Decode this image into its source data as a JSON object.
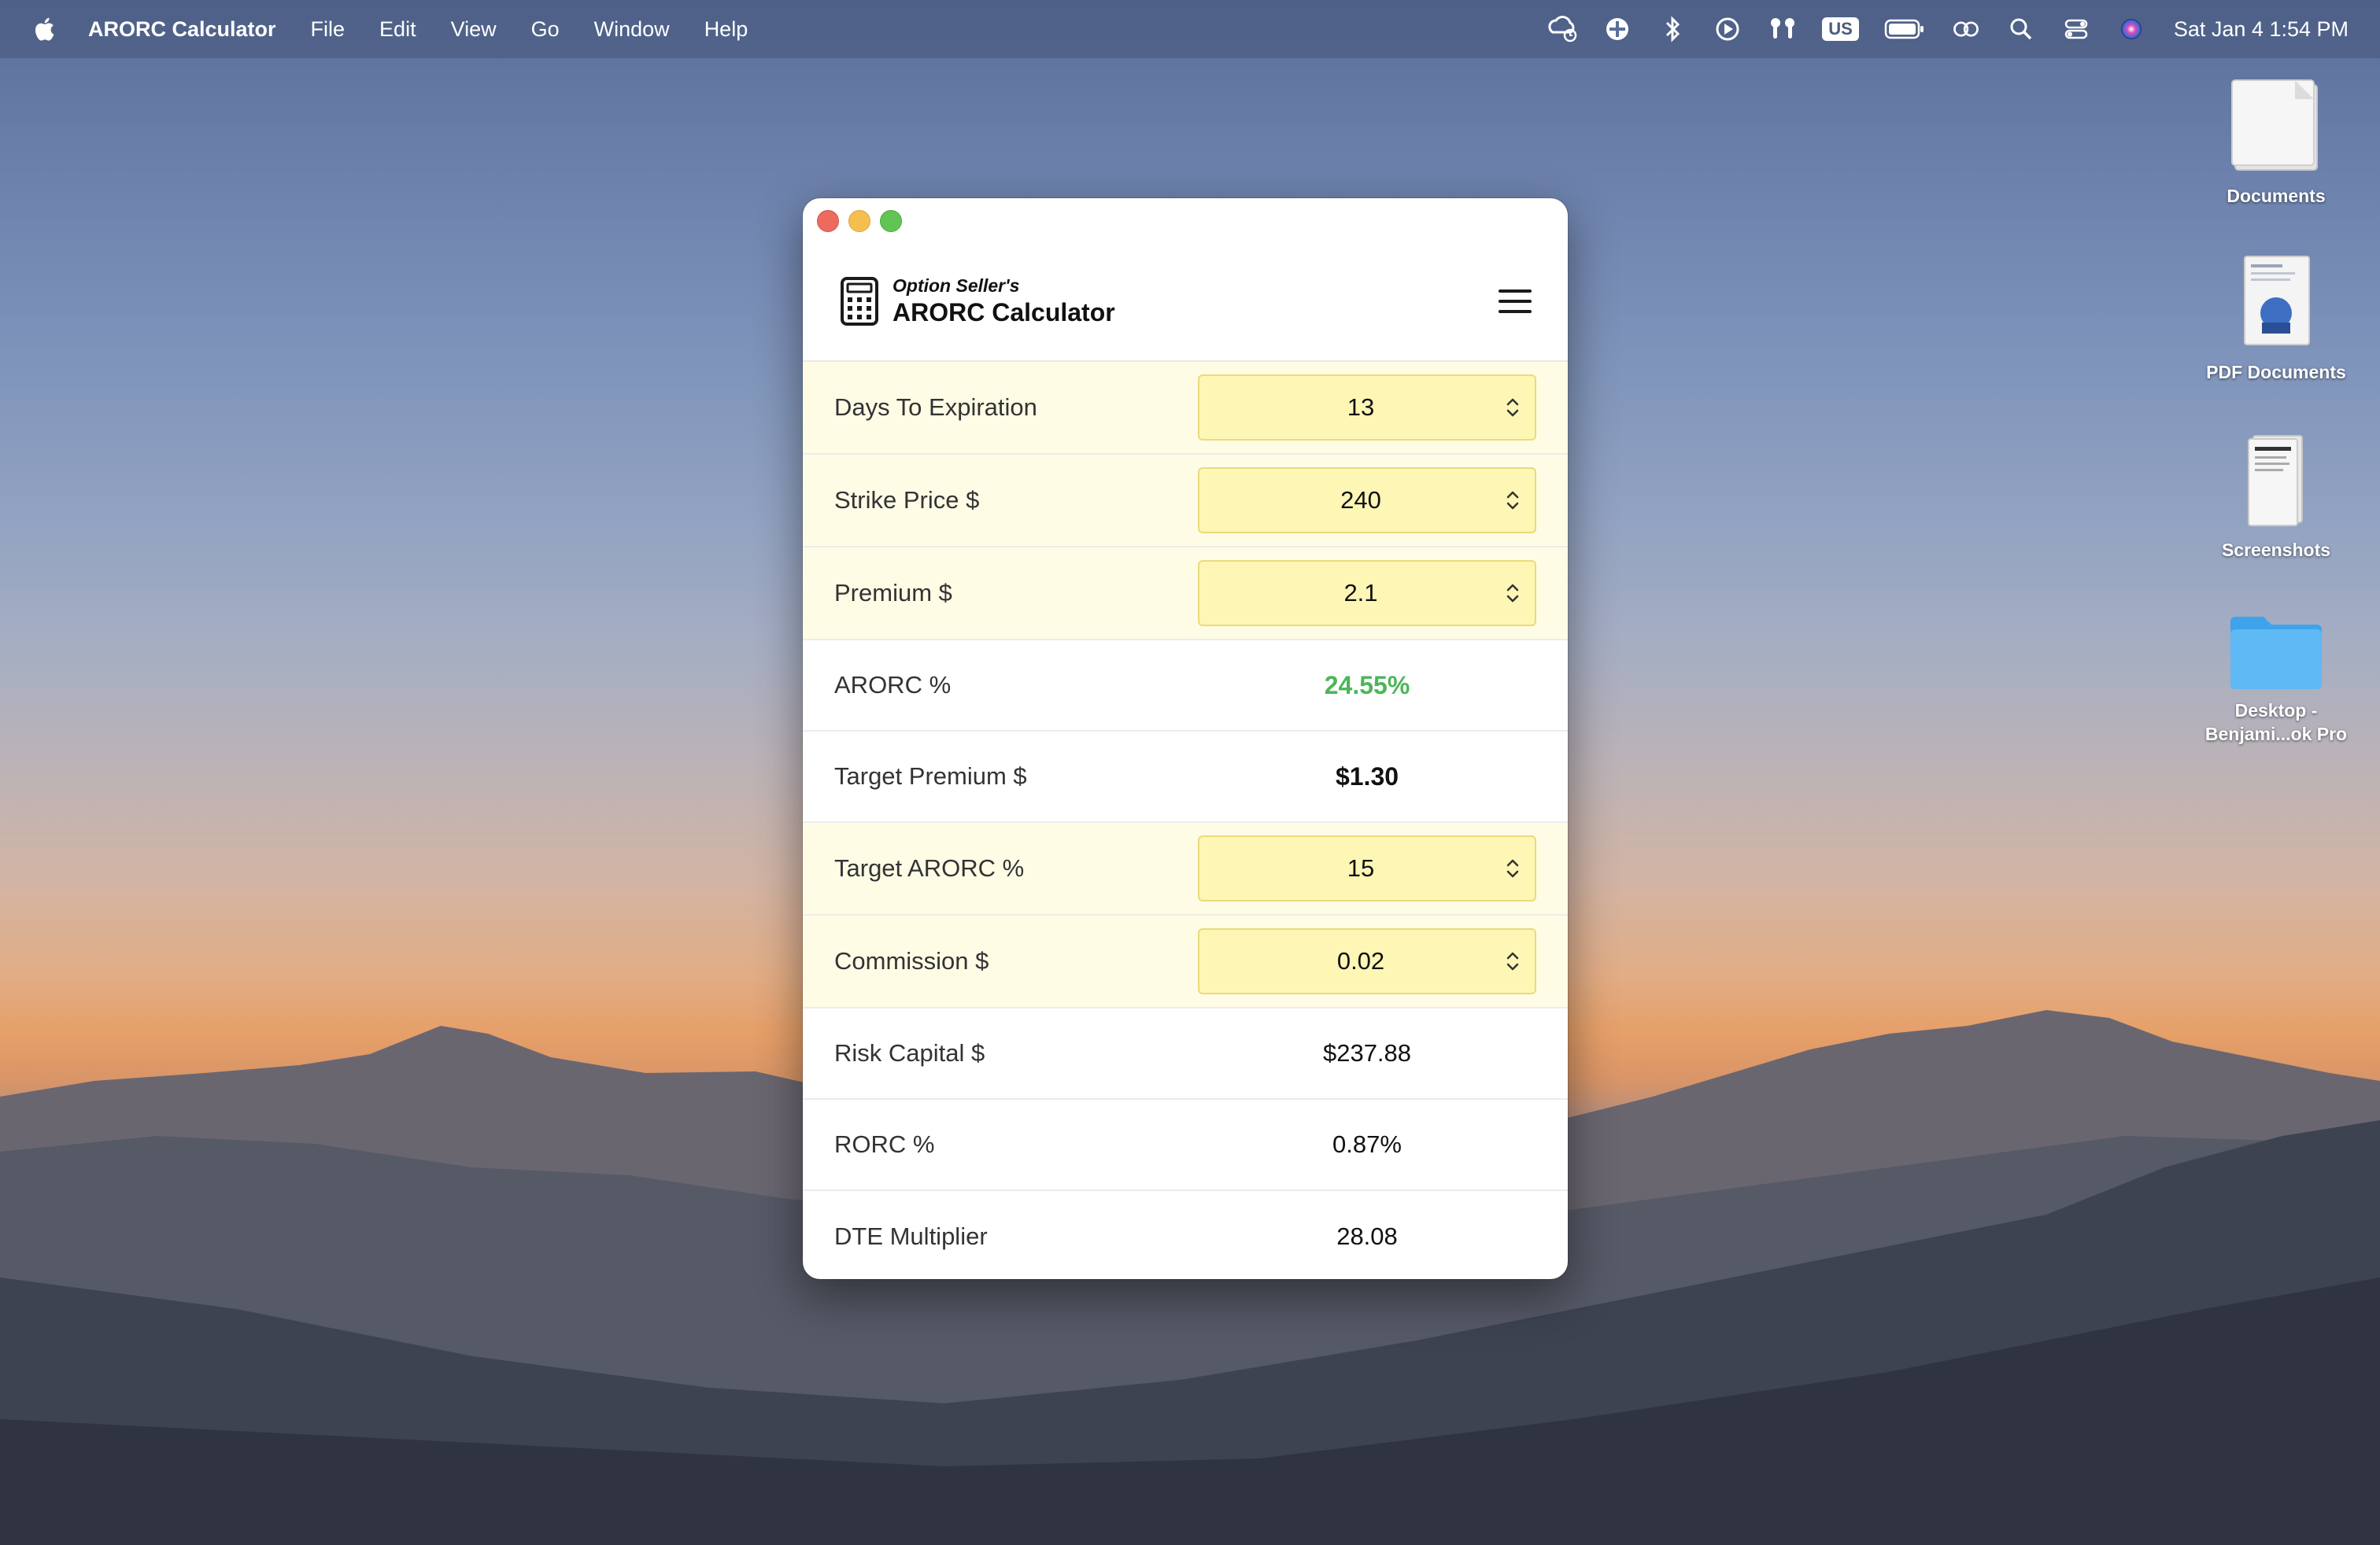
{
  "menubar": {
    "app_name": "ARORC Calculator",
    "items": [
      "File",
      "Edit",
      "View",
      "Go",
      "Window",
      "Help"
    ],
    "input_source": "US",
    "clock": "Sat Jan 4  1:54 PM"
  },
  "desktop_icons": [
    {
      "label": "Documents",
      "icon": "document-icon"
    },
    {
      "label": "PDF Documents",
      "icon": "pdf-document-icon"
    },
    {
      "label": "Screenshots",
      "icon": "screenshots-icon"
    },
    {
      "label": "Desktop - Benjami...ok Pro",
      "icon": "folder-icon"
    }
  ],
  "app": {
    "subtitle": "Option Seller's",
    "title": "ARORC Calculator",
    "rows": [
      {
        "label": "Days To Expiration",
        "type": "input",
        "value": "13"
      },
      {
        "label": "Strike Price $",
        "type": "input",
        "value": "240"
      },
      {
        "label": "Premium $",
        "type": "input",
        "value": "2.1"
      },
      {
        "label": "ARORC %",
        "type": "output",
        "value": "24.55%",
        "style": "green"
      },
      {
        "label": "Target Premium $",
        "type": "output",
        "value": "$1.30",
        "style": "bold"
      },
      {
        "label": "Target ARORC %",
        "type": "input",
        "value": "15"
      },
      {
        "label": "Commission $",
        "type": "input",
        "value": "0.02"
      },
      {
        "label": "Risk Capital $",
        "type": "output",
        "value": "$237.88",
        "style": "normal"
      },
      {
        "label": "RORC %",
        "type": "output",
        "value": "0.87%",
        "style": "normal"
      },
      {
        "label": "DTE Multiplier",
        "type": "output",
        "value": "28.08",
        "style": "normal"
      }
    ]
  },
  "colors": {
    "arorc_green": "#4cb65a",
    "input_bg": "#fdf6b5",
    "input_row_bg": "#fffce6"
  }
}
